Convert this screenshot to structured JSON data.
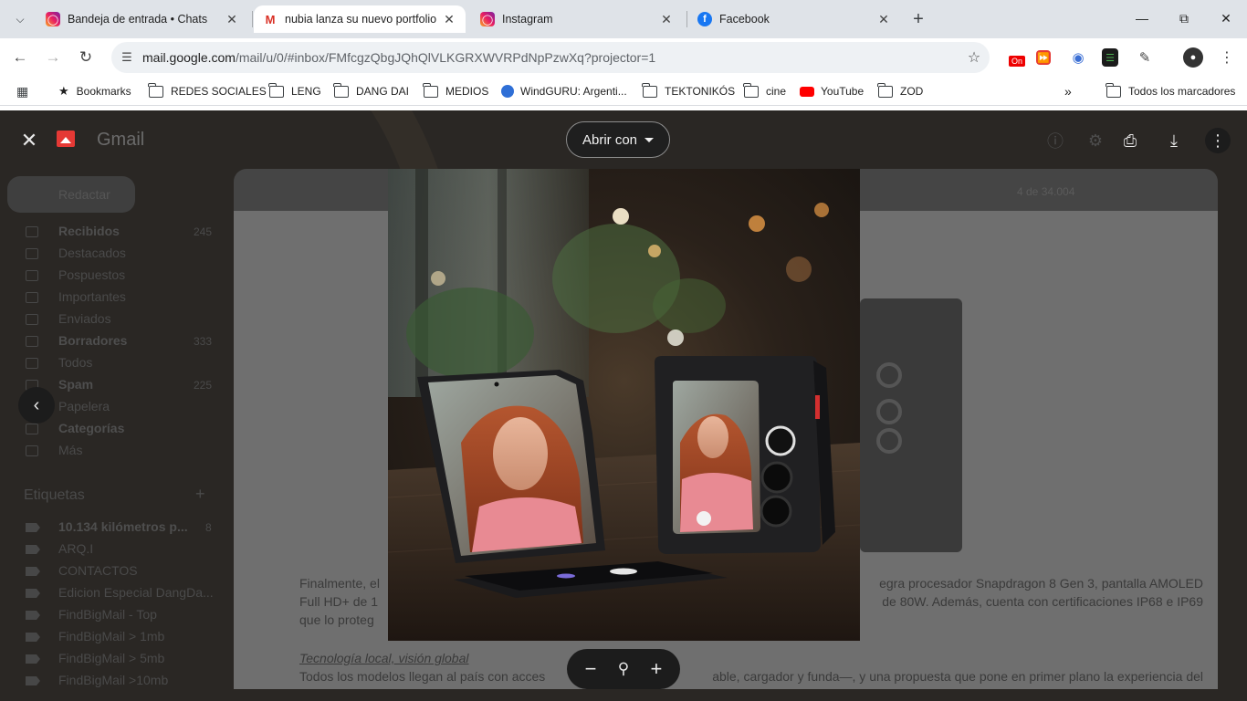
{
  "browser": {
    "tabs": [
      {
        "title": "Bandeja de entrada • Chats",
        "icon": "instagram-icon",
        "active": false
      },
      {
        "title": "nubia lanza su nuevo portfolio",
        "icon": "gmail-icon",
        "active": true
      },
      {
        "title": "Instagram",
        "icon": "instagram-icon",
        "active": false
      },
      {
        "title": "Facebook",
        "icon": "facebook-icon",
        "active": false
      }
    ],
    "url_host": "mail.google.com",
    "url_path": "/mail/u/0/#inbox/FMfcgzQbgJQhQlVLKGRXWVRPdNpPzwXq?projector=1",
    "bookmarks": [
      "Bookmarks",
      "REDES SOCIALES",
      "LENG",
      "DANG DAI",
      "MEDIOS",
      "WindGURU: Argenti...",
      "TEKTONIKÓS",
      "cine",
      "YouTube",
      "ZOD"
    ],
    "all_bookmarks": "Todos los marcadores",
    "ext_badge": "On"
  },
  "gmail": {
    "app_name": "Gmail",
    "compose": "Redactar",
    "nav": [
      {
        "label": "Recibidos",
        "count": "245",
        "bold": true
      },
      {
        "label": "Destacados",
        "count": "",
        "bold": false
      },
      {
        "label": "Pospuestos",
        "count": "",
        "bold": false
      },
      {
        "label": "Importantes",
        "count": "",
        "bold": false
      },
      {
        "label": "Enviados",
        "count": "",
        "bold": false
      },
      {
        "label": "Borradores",
        "count": "333",
        "bold": true
      },
      {
        "label": "Todos",
        "count": "",
        "bold": false
      },
      {
        "label": "Spam",
        "count": "225",
        "bold": true
      },
      {
        "label": "Papelera",
        "count": "",
        "bold": false
      },
      {
        "label": "Categorías",
        "count": "",
        "bold": true
      },
      {
        "label": "Más",
        "count": "",
        "bold": false
      }
    ],
    "labels_title": "Etiquetas",
    "labels": [
      {
        "label": "10.134 kilómetros p...",
        "count": "8",
        "bold": true
      },
      {
        "label": "ARQ.I",
        "count": "",
        "bold": false
      },
      {
        "label": "CONTACTOS",
        "count": "",
        "bold": false
      },
      {
        "label": "Edicion Especial DangDa...",
        "count": "",
        "bold": false
      },
      {
        "label": "FindBigMail - Top",
        "count": "",
        "bold": false
      },
      {
        "label": "FindBigMail > 1mb",
        "count": "",
        "bold": false
      },
      {
        "label": "FindBigMail > 5mb",
        "count": "",
        "bold": false
      },
      {
        "label": "FindBigMail >10mb",
        "count": "",
        "bold": false
      }
    ],
    "pager": "4 de 34.004",
    "body_para1_line1": "Finalmente, el",
    "body_para1_line1b": "egra procesador Snapdragon 8 Gen 3, pantalla AMOLED",
    "body_para1_line2": "Full HD+ de 1",
    "body_para1_line2b": "de 80W. Además, cuenta con certificaciones IP68 e IP69",
    "body_para1_line3": "que lo proteg",
    "body_heading": "Tecnología local, visión global",
    "body_para2": "Todos los modelos llegan al país con acces",
    "body_para2b": "able, cargador y funda—, y una propuesta que pone en primer plano la experiencia del"
  },
  "projector": {
    "open_with": "Abrir con"
  }
}
